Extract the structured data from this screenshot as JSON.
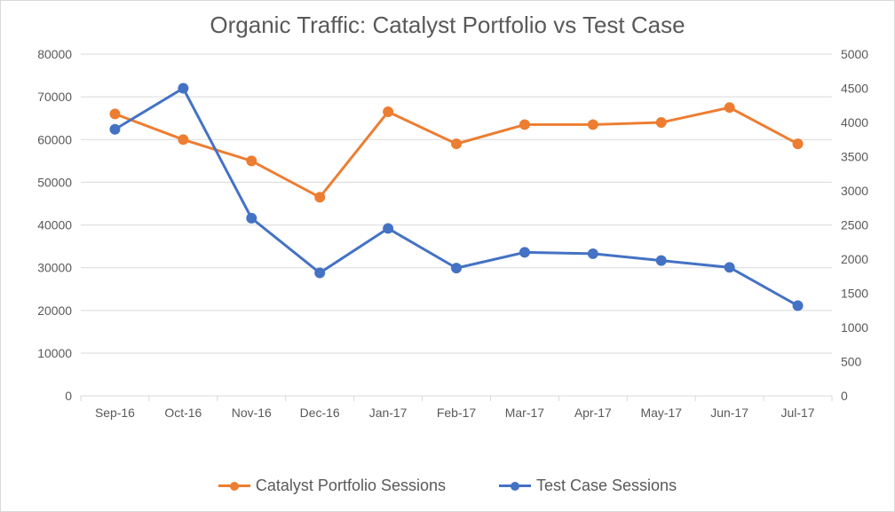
{
  "chart_data": {
    "type": "line",
    "title": "Organic Traffic: Catalyst Portfolio vs Test Case",
    "categories": [
      "Sep-16",
      "Oct-16",
      "Nov-16",
      "Dec-16",
      "Jan-17",
      "Feb-17",
      "Mar-17",
      "Apr-17",
      "May-17",
      "Jun-17",
      "Jul-17"
    ],
    "left_axis": {
      "min": 0,
      "max": 80000,
      "step": 10000
    },
    "right_axis": {
      "min": 0,
      "max": 5000,
      "step": 500
    },
    "series": [
      {
        "name": "Catalyst Portfolio Sessions",
        "axis": "left",
        "color": "#ed7d31",
        "values": [
          66000,
          60000,
          55000,
          46500,
          66500,
          59000,
          63500,
          63500,
          64000,
          67500,
          59000
        ]
      },
      {
        "name": "Test Case Sessions",
        "axis": "right",
        "color": "#4472c4",
        "values": [
          3900,
          4500,
          2600,
          1800,
          2450,
          1870,
          2100,
          2080,
          1980,
          1880,
          1320
        ]
      }
    ],
    "xlabel": "",
    "ylabel": ""
  }
}
